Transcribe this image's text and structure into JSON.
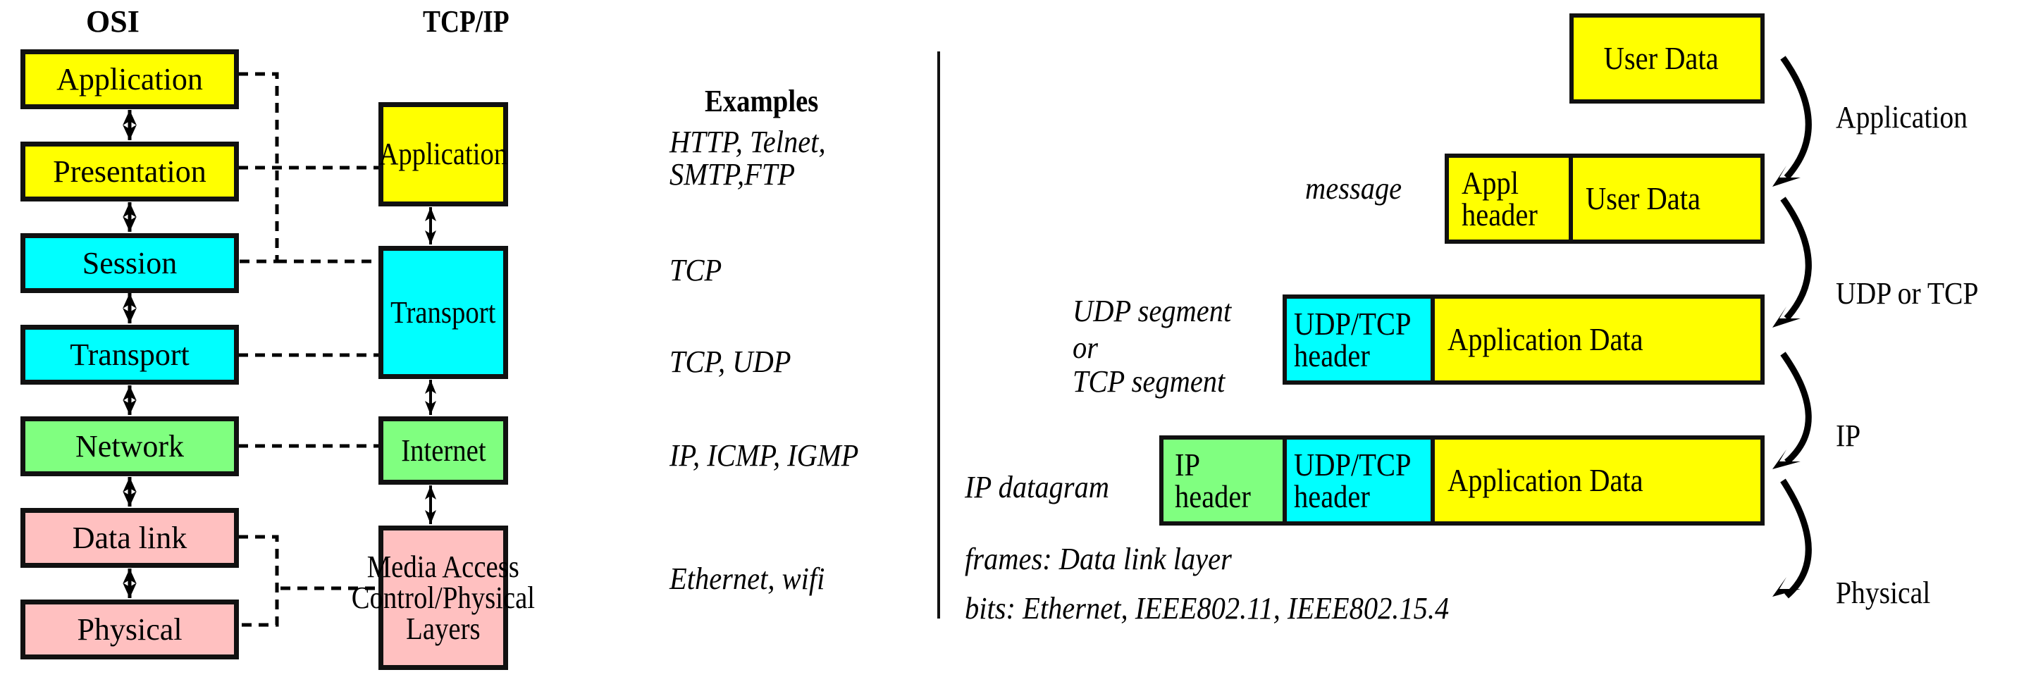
{
  "left": {
    "osi_title": "OSI",
    "tcpip_title": "TCP/IP",
    "examples_title": "Examples",
    "osi_layers": [
      {
        "label": "Application",
        "color": "#ffff00"
      },
      {
        "label": "Presentation",
        "color": "#ffff00"
      },
      {
        "label": "Session",
        "color": "#00ffff"
      },
      {
        "label": "Transport",
        "color": "#00ffff"
      },
      {
        "label": "Network",
        "color": "#80ff80"
      },
      {
        "label": "Data link",
        "color": "#ffc0c0"
      },
      {
        "label": "Physical",
        "color": "#ffc0c0"
      }
    ],
    "tcpip_layers": [
      {
        "label": "Application",
        "color": "#ffff00"
      },
      {
        "label": "Transport",
        "color": "#00ffff"
      },
      {
        "label": "Internet",
        "color": "#80ff80"
      },
      {
        "label": "Media Access Control/Physical Layers",
        "line1": "Media Access",
        "line2": "Control/Physical",
        "line3": "Layers",
        "color": "#ffc0c0"
      }
    ],
    "examples": {
      "application_line1": "HTTP, Telnet,",
      "application_line2": "SMTP,FTP",
      "transport_tcp": "TCP",
      "transport_tcp_udp": "TCP, UDP",
      "internet": "IP, ICMP, IGMP",
      "mac_physical": "Ethernet, wifi"
    }
  },
  "right": {
    "rows": [
      {
        "name": "user-data",
        "caption": "",
        "segments": [
          {
            "label": "User Data",
            "color": "#ffff00"
          }
        ]
      },
      {
        "name": "message",
        "caption": "message",
        "segments": [
          {
            "line1": "Appl",
            "line2": "header",
            "color": "#ffff00"
          },
          {
            "label": "User Data",
            "color": "#ffff00"
          }
        ]
      },
      {
        "name": "segment",
        "caption_line1": "UDP segment",
        "caption_line2": "or",
        "caption_line3": "TCP segment",
        "segments": [
          {
            "line1": "UDP/TCP",
            "line2": "header",
            "color": "#00ffff"
          },
          {
            "label": "Application Data",
            "color": "#ffff00"
          }
        ]
      },
      {
        "name": "datagram",
        "caption": "IP datagram",
        "segments": [
          {
            "line1": "IP",
            "line2": "header",
            "color": "#80ff80"
          },
          {
            "line1": "UDP/TCP",
            "line2": "header",
            "color": "#00ffff"
          },
          {
            "label": "Application Data",
            "color": "#ffff00"
          }
        ]
      }
    ],
    "transitions": [
      "Application",
      "UDP or TCP",
      "IP",
      "Physical"
    ],
    "frames_note": "frames: Data link layer",
    "bits_note": "bits: Ethernet, IEEE802.11, IEEE802.15.4"
  }
}
